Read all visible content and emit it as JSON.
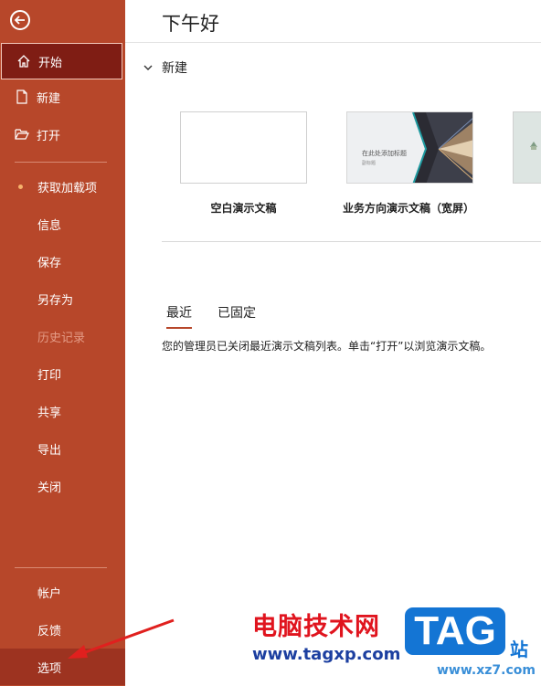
{
  "sidebar": {
    "items": [
      {
        "label": "开始"
      },
      {
        "label": "新建"
      },
      {
        "label": "打开"
      },
      {
        "label": "获取加载项"
      },
      {
        "label": "信息"
      },
      {
        "label": "保存"
      },
      {
        "label": "另存为"
      },
      {
        "label": "历史记录"
      },
      {
        "label": "打印"
      },
      {
        "label": "共享"
      },
      {
        "label": "导出"
      },
      {
        "label": "关闭"
      }
    ],
    "bottom_items": [
      {
        "label": "帐户"
      },
      {
        "label": "反馈"
      },
      {
        "label": "选项"
      }
    ],
    "colors": {
      "background": "#b7472a",
      "active": "#7f1d14"
    }
  },
  "main": {
    "greeting": "下午好",
    "new_section": {
      "title": "新建",
      "templates": [
        {
          "label": "空白演示文稿"
        },
        {
          "label": "业务方向演示文稿（宽屏）",
          "thumb_title": "在此处添加标题",
          "thumb_sub": "副标题"
        },
        {
          "label": ""
        }
      ]
    },
    "tabs": [
      {
        "label": "最近"
      },
      {
        "label": "已固定"
      }
    ],
    "notice": "您的管理员已关闭最近演示文稿列表。单击“打开”以浏览演示文稿。"
  },
  "watermark": {
    "text": "电脑技术网",
    "url": "www.tagxp.com",
    "logo": "TAG",
    "site": "站",
    "xz": "www.xz7.com"
  }
}
